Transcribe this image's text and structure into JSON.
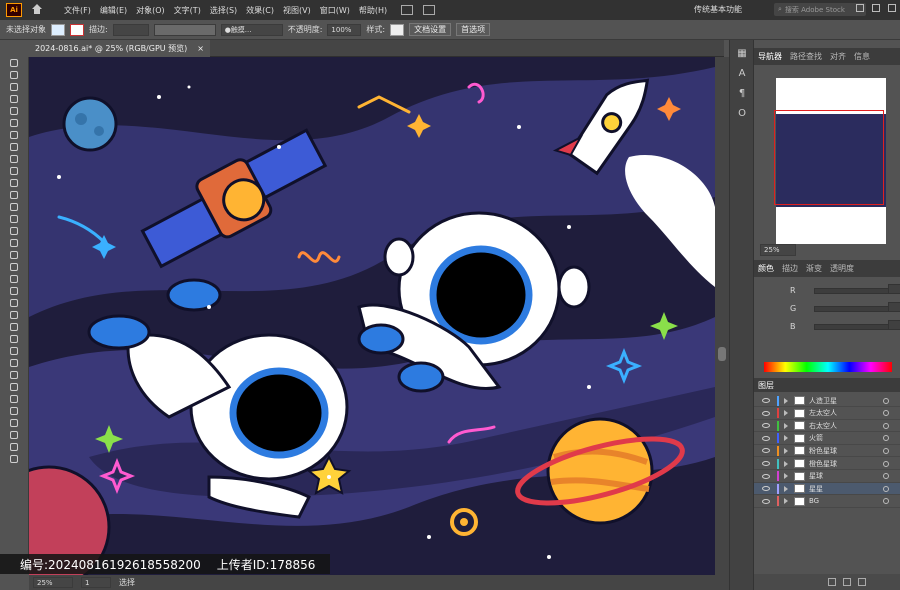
{
  "app": {
    "logo": "Ai",
    "workspace": "传统基本功能",
    "stock_placeholder": "搜索 Adobe Stock"
  },
  "menu": [
    "文件(F)",
    "编辑(E)",
    "对象(O)",
    "文字(T)",
    "选择(S)",
    "效果(C)",
    "视图(V)",
    "窗口(W)",
    "帮助(H)"
  ],
  "control": {
    "no_selection": "未选择对象",
    "stroke_label": "描边:",
    "brush_label": "触摸...",
    "opacity_label": "不透明度:",
    "opacity_value": "100%",
    "style_label": "样式:",
    "doc_setup": "文档设置",
    "prefs": "首选项"
  },
  "document_tab": {
    "title": "2024-0816.ai* @ 25% (RGB/GPU 预览)",
    "close": "×"
  },
  "status": {
    "zoom": "25%",
    "artboard": "1",
    "tool": "选择"
  },
  "panels": {
    "nav_tabs": [
      "导航器",
      "路径查找",
      "对齐",
      "信息"
    ],
    "nav_zoom": "25%",
    "color_tabs": [
      "颜色",
      "描边",
      "渐变",
      "透明度"
    ],
    "color_channels": [
      "R",
      "G",
      "B"
    ],
    "layers_title": "图层",
    "layers": [
      {
        "name": "人造卫星",
        "color": "#4fa3ff"
      },
      {
        "name": "左太空人",
        "color": "#e04040"
      },
      {
        "name": "右太空人",
        "color": "#40c040"
      },
      {
        "name": "火箭",
        "color": "#4060ff"
      },
      {
        "name": "粉色星球",
        "color": "#f09020"
      },
      {
        "name": "橙色星球",
        "color": "#40c0c0"
      },
      {
        "name": "星球",
        "color": "#d040d0"
      },
      {
        "name": "星星",
        "color": "#a0a0ff"
      },
      {
        "name": "BG",
        "color": "#e06060"
      }
    ],
    "selected_layer": "星星"
  },
  "watermark": {
    "id_label": "编号:",
    "id_value": "20240816192618558200",
    "uploader_label": "上传者ID:",
    "uploader_value": "178856"
  },
  "colors": {
    "accent": "#4c5a6e",
    "background": "#535353",
    "canvas_bg": "#2b2c5e"
  }
}
